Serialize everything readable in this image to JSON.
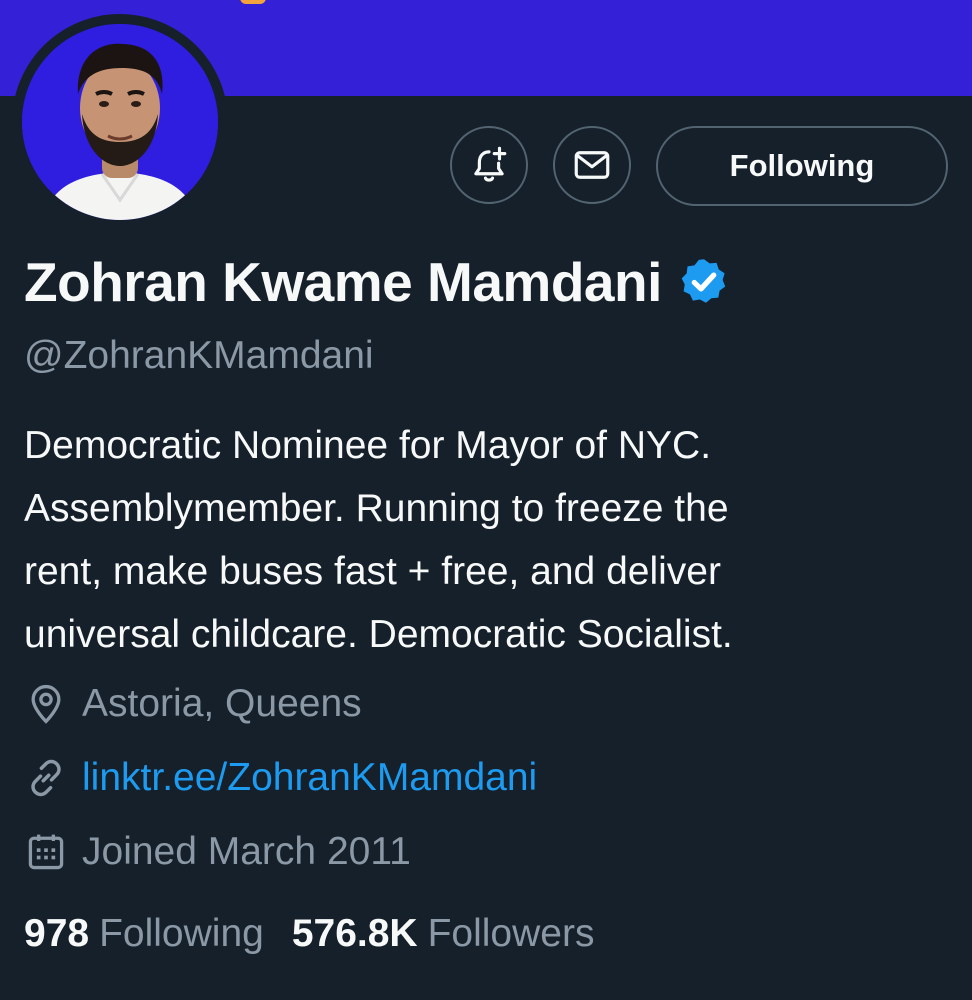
{
  "profile": {
    "display_name": "Zohran Kwame Mamdani",
    "handle": "@ZohranKMamdani",
    "verified": true,
    "bio_lines": [
      "Democratic Nominee for Mayor of NYC.",
      "Assemblymember. Running to freeze the",
      "rent, make buses fast + free, and deliver",
      "universal childcare. Democratic Socialist."
    ],
    "location": "Astoria, Queens",
    "link": "linktr.ee/ZohranKMamdani",
    "joined": "Joined March 2011"
  },
  "actions": {
    "notify_icon": "bell-plus-icon",
    "message_icon": "envelope-icon",
    "follow_label": "Following"
  },
  "stats": {
    "following_count": "978",
    "following_label": "Following",
    "followers_count": "576.8K",
    "followers_label": "Followers"
  },
  "colors": {
    "background": "#15202b",
    "banner": "#3420d6",
    "link": "#1d9bf0",
    "verified": "#1d9bf0",
    "secondary_text": "#8b98a5"
  }
}
